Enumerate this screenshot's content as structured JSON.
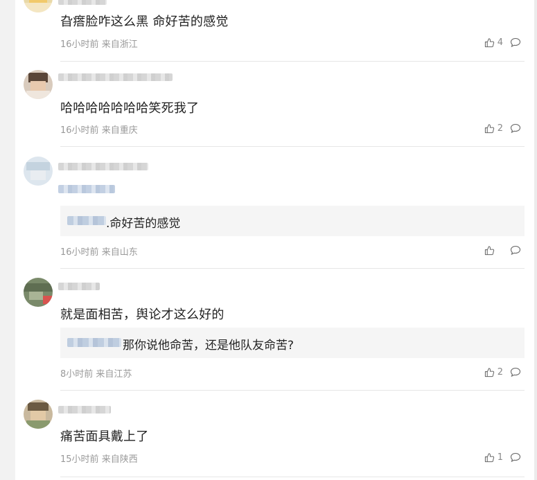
{
  "comments": [
    {
      "text": "旮瘩脸咋这么黑 命好苦的感觉",
      "time": "16小时前",
      "location": "来自浙江",
      "likes": "4"
    },
    {
      "text": "哈哈哈哈哈哈哈笑死我了",
      "time": "16小时前",
      "location": "来自重庆",
      "likes": "2"
    },
    {
      "quote_text": ".命好苦的感觉",
      "time": "16小时前",
      "location": "来自山东",
      "likes": ""
    },
    {
      "text": "就是面相苦，舆论才这么好的",
      "quote_text": "那你说他命苦，还是他队友命苦?",
      "time": "8小时前",
      "location": "来自江苏",
      "likes": "2"
    },
    {
      "text": "痛苦面具戴上了",
      "time": "15小时前",
      "location": "来自陕西",
      "likes": "1"
    }
  ],
  "icons": {
    "like": "thumbs-up-icon",
    "reply": "comment-bubble-icon"
  },
  "colors": {
    "text": "#222222",
    "meta": "#999999",
    "quote_bg": "#f5f5f5",
    "page_bg": "#f2f2f2"
  }
}
